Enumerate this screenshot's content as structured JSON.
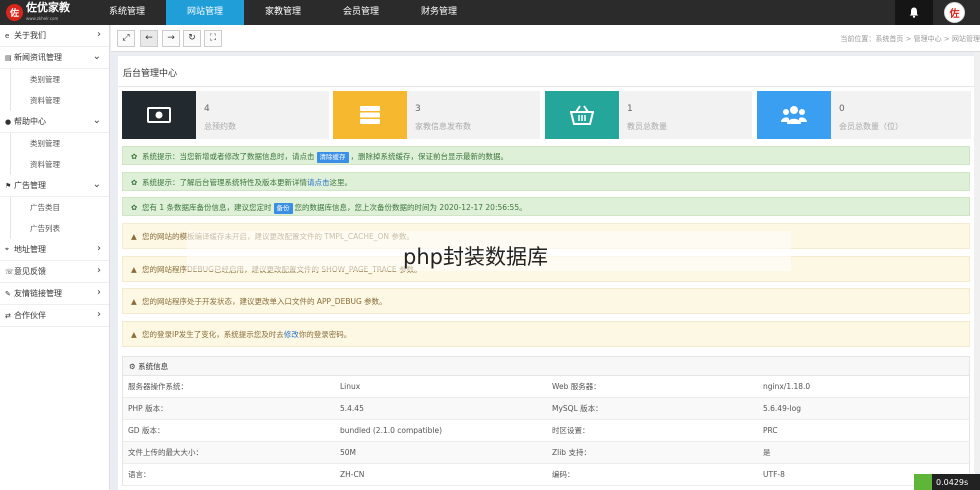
{
  "logo": {
    "mark": "佐",
    "text": "佐优家教",
    "sub": "www.zkhelr.com"
  },
  "topnav": [
    "系统管理",
    "网站管理",
    "家教管理",
    "会员管理",
    "财务管理"
  ],
  "sidebar": {
    "items": [
      {
        "icon": "e",
        "label": "关于我们"
      },
      {
        "icon": "▤",
        "label": "新闻资讯管理",
        "subs": [
          "类别管理",
          "资料管理"
        ]
      },
      {
        "icon": "●",
        "label": "帮助中心",
        "subs": [
          "类别管理",
          "资料管理"
        ]
      },
      {
        "icon": "⚑",
        "label": "广告管理",
        "subs": [
          "广告类目",
          "广告列表"
        ]
      },
      {
        "icon": "⌖",
        "label": "地址管理"
      },
      {
        "icon": "☏",
        "label": "意见反馈"
      },
      {
        "icon": "✎",
        "label": "友情链接管理"
      },
      {
        "icon": "⇄",
        "label": "合作伙伴"
      }
    ]
  },
  "breadcrumb": "当前位置：系统首页 > 管理中心 > 网站管理",
  "main_title": "后台管理中心",
  "stats": [
    {
      "num": "4",
      "label": "总预约数",
      "color": "#222a30"
    },
    {
      "num": "3",
      "label": "家教信息发布数",
      "color": "#f5b82e"
    },
    {
      "num": "1",
      "label": "教员总数量",
      "color": "#25a69a"
    },
    {
      "num": "0",
      "label": "会员总数量（位）",
      "color": "#3a9ff1"
    }
  ],
  "notes": {
    "n1a": "系统提示：当您新增或者修改了数据信息时，请点击",
    "n1btn": "清除缓存",
    "n1b": "，删除掉系统缓存，保证前台显示最新的数据。",
    "n2a": "系统提示：了解后台管理系统特性及版本更新详情",
    "n2link": "请点击",
    "n2b": "这里。",
    "n3a": "您有 1 条数据库备份信息，建议您定时",
    "n3btn": "备份",
    "n3b": "您的数据库信息，您上次备份数据的时间为 2020-12-17 20:56:55。",
    "w1": "您的网站的模板编译缓存未开启，建议更改配置文件的 TMPL_CACHE_ON 参数。",
    "w2": "您的网站程序DEBUG已经启用，建议更改配置文件的 SHOW_PAGE_TRACE 参数。",
    "w3": "您的网站程序处于开发状态，建议更改单入口文件的 APP_DEBUG 参数。",
    "w4a": "您的登录IP发生了变化，系统提示您及时去",
    "w4link": "修改",
    "w4b": "你的登录密码。"
  },
  "overlay": "php封装数据库",
  "sys": {
    "title": "系统信息",
    "rows": [
      [
        "服务器操作系统：",
        "Linux",
        "Web 服务器：",
        "nginx/1.18.0"
      ],
      [
        "PHP 版本：",
        "5.4.45",
        "MySQL 版本：",
        "5.6.49-log"
      ],
      [
        "GD 版本：",
        "bundled (2.1.0 compatible)",
        "时区设置：",
        "PRC"
      ],
      [
        "文件上传的最大大小：",
        "50M",
        "Zlib 支持：",
        "是"
      ],
      [
        "语言：",
        "ZH-CN",
        "编码：",
        "UTF-8"
      ]
    ]
  },
  "timer": "0.0429s"
}
